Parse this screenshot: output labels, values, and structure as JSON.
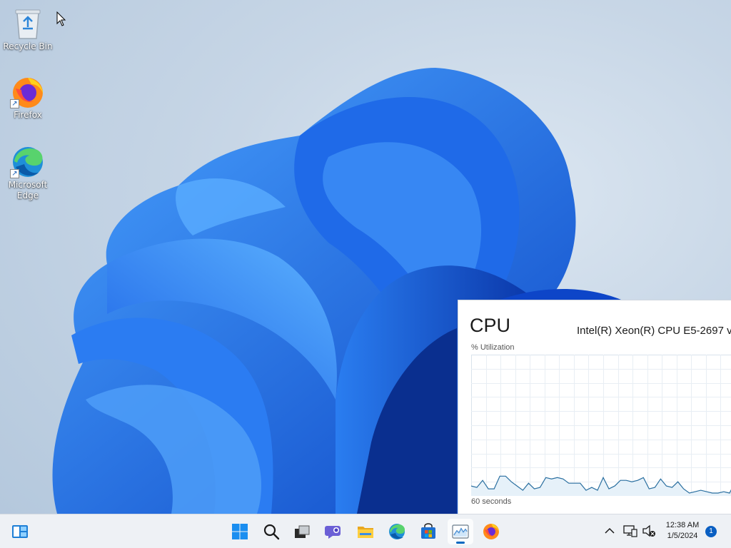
{
  "desktop": {
    "icons": [
      {
        "label": "Recycle Bin",
        "icon": "recycle-bin-icon"
      },
      {
        "label": "Firefox",
        "icon": "firefox-icon"
      },
      {
        "label": "Microsoft Edge",
        "icon": "edge-icon"
      }
    ]
  },
  "cpu_widget": {
    "title": "CPU",
    "model": "Intel(R) Xeon(R) CPU E5-2697 v",
    "utilization_label": "% Utilization",
    "time_label": "60 seconds",
    "utilization_history": [
      7,
      6,
      11,
      5,
      5,
      14,
      14,
      10,
      7,
      4,
      9,
      5,
      6,
      13,
      12,
      13,
      12,
      9,
      9,
      9,
      4,
      6,
      4,
      13,
      5,
      7,
      11,
      11,
      10,
      11,
      13,
      5,
      6,
      12,
      7,
      6,
      10,
      5,
      2,
      3,
      4,
      3,
      2,
      2,
      3,
      2,
      10
    ]
  },
  "taskbar": {
    "buttons": [
      {
        "name": "widgets",
        "icon": "widgets-icon"
      },
      {
        "name": "start",
        "icon": "windows-start-icon"
      },
      {
        "name": "search",
        "icon": "search-icon"
      },
      {
        "name": "task-view",
        "icon": "task-view-icon"
      },
      {
        "name": "chat",
        "icon": "teams-chat-icon"
      },
      {
        "name": "file-explorer",
        "icon": "folder-icon"
      },
      {
        "name": "edge",
        "icon": "edge-icon"
      },
      {
        "name": "store",
        "icon": "store-icon"
      },
      {
        "name": "task-manager",
        "icon": "task-manager-icon"
      },
      {
        "name": "firefox",
        "icon": "firefox-icon"
      }
    ],
    "tray": {
      "chevron_icon": "chevron-up-icon",
      "network_icon": "network-icon",
      "volume_icon": "speaker-muted-icon",
      "time": "12:38 AM",
      "date": "1/5/2024",
      "notification_count": "1"
    }
  },
  "colors": {
    "accent": "#0067c0",
    "bloom_dark": "#0a3fb8",
    "bloom_mid": "#1565e0",
    "bloom_light": "#3d8ef5",
    "cpu_line": "#2a6fa0",
    "cpu_fill": "#e6f1f9"
  }
}
